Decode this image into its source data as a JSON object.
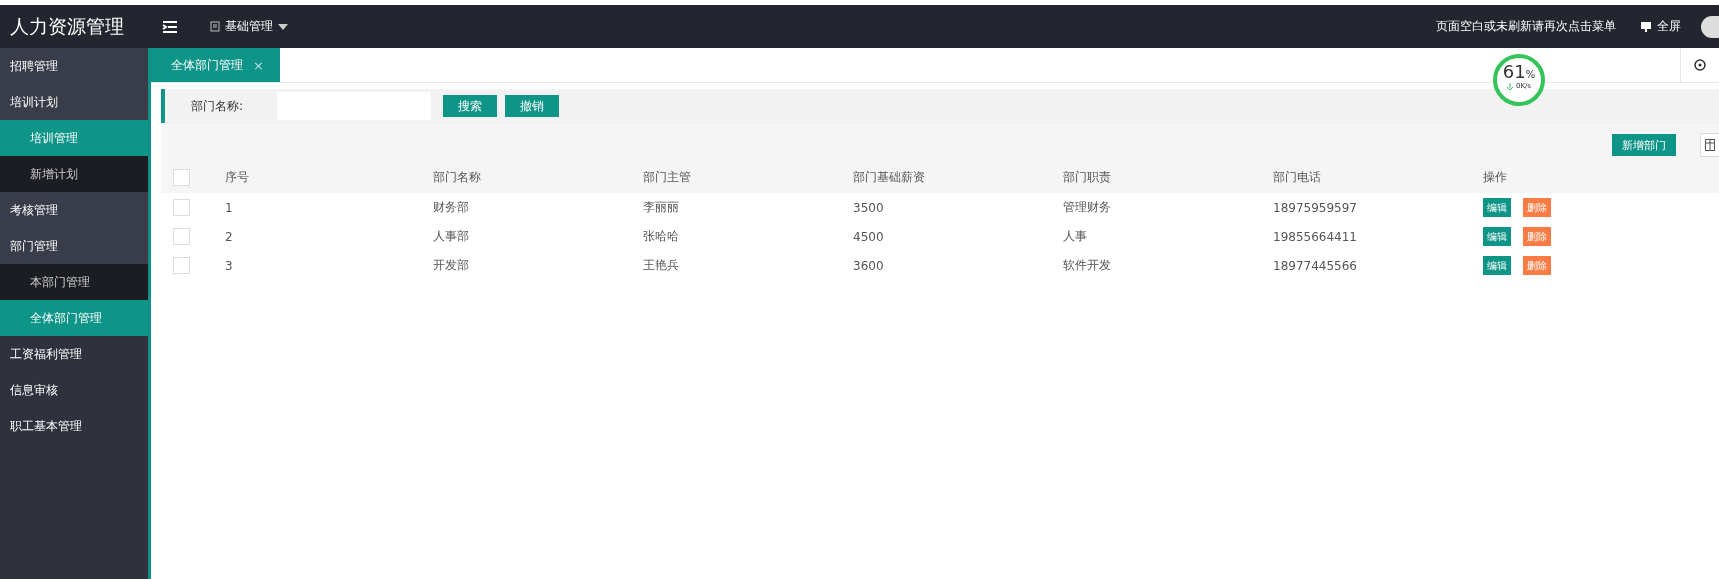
{
  "header": {
    "title": "人力资源管理",
    "menu": "基础管理",
    "notice": "页面空白或未刷新请再次点击菜单",
    "fullscreen": "全屏"
  },
  "sidebar": {
    "items": [
      {
        "label": "招聘管理"
      },
      {
        "label": "培训计划",
        "children": [
          {
            "label": "培训管理",
            "selected": true
          },
          {
            "label": "新增计划",
            "selected": false
          }
        ]
      },
      {
        "label": "考核管理"
      },
      {
        "label": "部门管理",
        "children": [
          {
            "label": "本部门管理",
            "selected": false
          },
          {
            "label": "全体部门管理",
            "selected": true
          }
        ]
      },
      {
        "label": "工资福利管理"
      },
      {
        "label": "信息审核"
      },
      {
        "label": "职工基本管理"
      }
    ]
  },
  "tabs": [
    {
      "label": "全体部门管理",
      "selected": true,
      "close": "×"
    }
  ],
  "net_meter": {
    "percent": "61",
    "unit": "%",
    "speed": "0K/s"
  },
  "search": {
    "label": "部门名称:",
    "search_button": "搜索",
    "reset_button": "撤销"
  },
  "toolbar": {
    "add_button": "新增部门"
  },
  "table": {
    "select_all_checked": false,
    "columns": [
      "序号",
      "部门名称",
      "部门主管",
      "部门基础薪资",
      "部门职责",
      "部门电话",
      "操作"
    ],
    "rows": [
      {
        "checked": false,
        "cells": [
          "1",
          "财务部",
          "李丽丽",
          "3500",
          "管理财务",
          "18975959597"
        ],
        "edit": "编辑",
        "delete": "删除"
      },
      {
        "checked": false,
        "cells": [
          "2",
          "人事部",
          "张哈哈",
          "4500",
          "人事",
          "19855664411"
        ],
        "edit": "编辑",
        "delete": "删除"
      },
      {
        "checked": false,
        "cells": [
          "3",
          "开发部",
          "王艳兵",
          "3600",
          "软件开发",
          "18977445566"
        ],
        "edit": "编辑",
        "delete": "删除"
      }
    ]
  }
}
